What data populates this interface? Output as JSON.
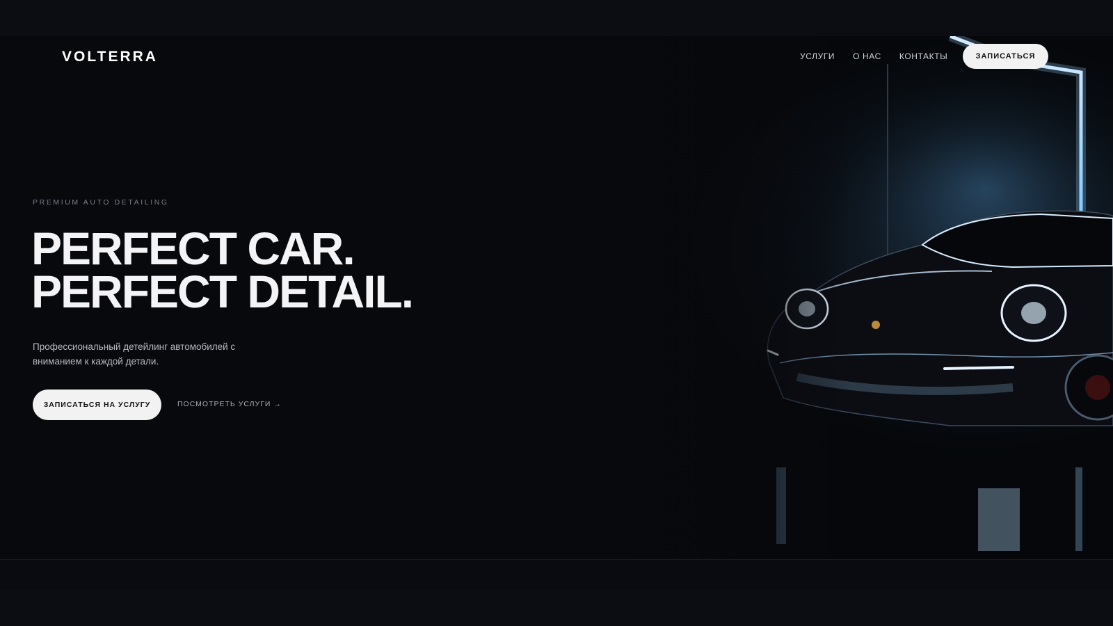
{
  "brand": {
    "logo": "VOLTERRA"
  },
  "nav": {
    "items": [
      {
        "label": "УСЛУГИ"
      },
      {
        "label": "О НАС"
      },
      {
        "label": "КОНТАКТЫ"
      }
    ],
    "cta_label": "ЗАПИСАТЬСЯ"
  },
  "hero": {
    "eyebrow": "PREMIUM AUTO DETAILING",
    "headline_line1": "PERFECT CAR.",
    "headline_line2": "PERFECT DETAIL.",
    "subtitle": "Профессиональный детейлинг автомобилей с вниманием к каждой детали.",
    "primary_cta": "ЗАПИСАТЬСЯ НА УСЛУГУ",
    "secondary_cta": "ПОСМОТРЕТЬ УСЛУГИ →"
  },
  "colors": {
    "background": "#08090d",
    "accent_light": "#bfe6ff",
    "button_bg": "#f2f2f2"
  }
}
